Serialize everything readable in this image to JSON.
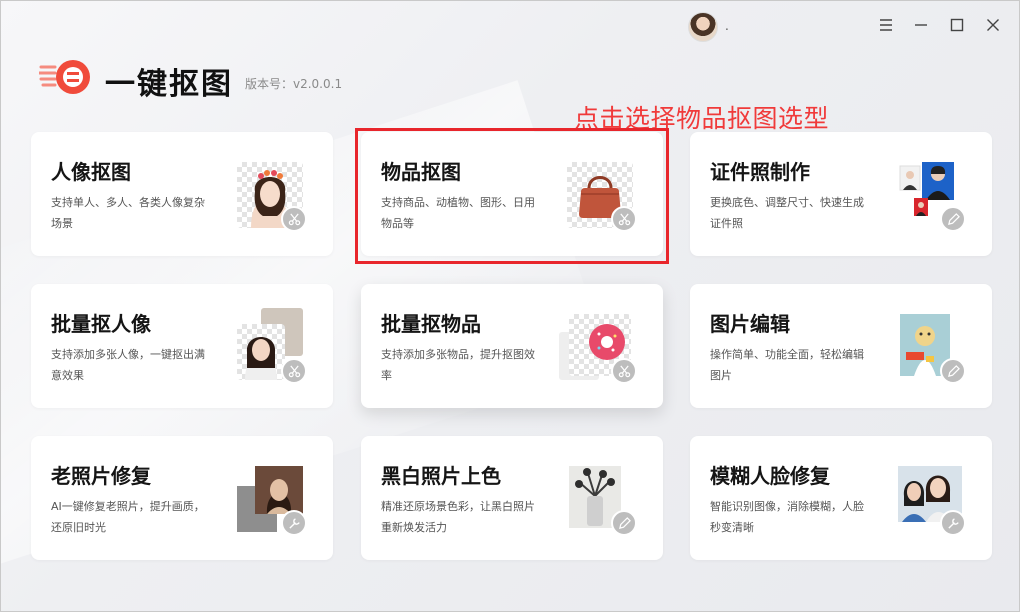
{
  "app": {
    "title": "一键抠图",
    "version": "版本号：v2.0.0.1",
    "user_name": ".",
    "brand_color": "#f04b3b"
  },
  "window_controls": [
    {
      "name": "menu-icon"
    },
    {
      "name": "minimize-icon"
    },
    {
      "name": "maximize-icon"
    },
    {
      "name": "close-icon"
    }
  ],
  "annotation": {
    "text": "点击选择物品抠图选型",
    "color": "#f03a3a"
  },
  "cards": [
    {
      "title": "人像抠图",
      "desc": "支持单人、多人、各类人像复杂场景",
      "thumb": "portrait",
      "badge": "scissors-icon"
    },
    {
      "title": "物品抠图",
      "desc": "支持商品、动植物、图形、日用物品等",
      "thumb": "handbag",
      "badge": "scissors-icon",
      "highlighted": true
    },
    {
      "title": "证件照制作",
      "desc": "更换底色、调整尺寸、快速生成证件照",
      "thumb": "id-photo",
      "badge": "pencil-icon"
    },
    {
      "title": "批量抠人像",
      "desc": "支持添加多张人像，一键抠出满意效果",
      "thumb": "portrait-batch",
      "badge": "scissors-icon"
    },
    {
      "title": "批量抠物品",
      "desc": "支持添加多张物品，提升抠图效率",
      "thumb": "donut",
      "badge": "scissors-icon"
    },
    {
      "title": "图片编辑",
      "desc": "操作简单、功能全面，轻松编辑图片",
      "thumb": "edit",
      "badge": "pencil-icon"
    },
    {
      "title": "老照片修复",
      "desc": "AI一键修复老照片，提升画质，还原旧时光",
      "thumb": "old-photo",
      "badge": "wrench-icon"
    },
    {
      "title": "黑白照片上色",
      "desc": "精准还原场景色彩，让黑白照片重新焕发活力",
      "thumb": "vase",
      "badge": "wrench-icon"
    },
    {
      "title": "模糊人脸修复",
      "desc": "智能识别图像，消除模糊，人脸秒变清晰",
      "thumb": "faces",
      "badge": "wrench-icon"
    }
  ]
}
